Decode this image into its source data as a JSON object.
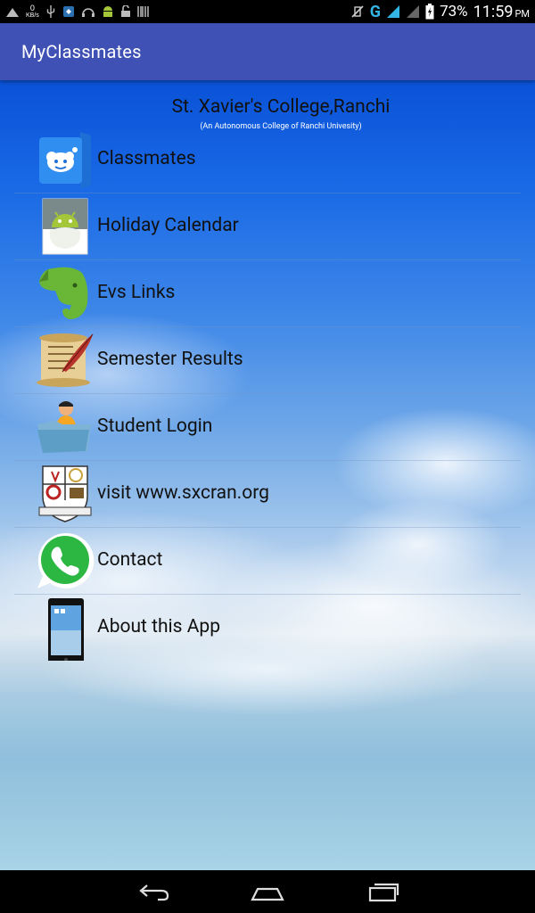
{
  "status_bar": {
    "speed_value": "0",
    "speed_unit": "KB/s",
    "battery": "73%",
    "time": "11:59",
    "ampm": "PM",
    "network": "G"
  },
  "app_bar": {
    "title": "MyClassmates"
  },
  "header": {
    "college": "St. Xavier's College,Ranchi",
    "subtitle": "(An Autonomous College of Ranchi Univesity)"
  },
  "menu": {
    "items": [
      {
        "label": "Classmates",
        "icon": "smiley-cloud-icon"
      },
      {
        "label": "Holiday Calendar",
        "icon": "android-calendar-icon"
      },
      {
        "label": "Evs Links",
        "icon": "evernote-elephant-icon"
      },
      {
        "label": "Semester Results",
        "icon": "scroll-quill-icon"
      },
      {
        "label": "Student Login",
        "icon": "student-folder-icon"
      },
      {
        "label": "visit www.sxcran.org",
        "icon": "college-crest-icon"
      },
      {
        "label": "Contact",
        "icon": "whatsapp-icon"
      },
      {
        "label": "About this App",
        "icon": "phone-icon"
      }
    ]
  },
  "colors": {
    "app_bar": "#3f51b5",
    "status_bar": "#000000",
    "nav_bar": "#000000"
  }
}
